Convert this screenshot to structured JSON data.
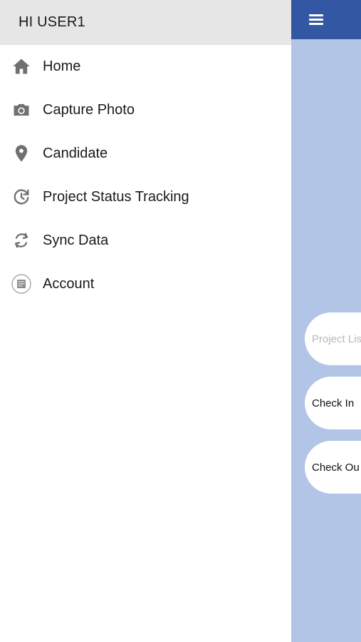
{
  "drawer": {
    "greeting": "HI USER1",
    "items": [
      {
        "label": "Home",
        "icon": "home-icon"
      },
      {
        "label": "Capture Photo",
        "icon": "camera-icon"
      },
      {
        "label": "Candidate",
        "icon": "location-pin-icon"
      },
      {
        "label": "Project Status Tracking",
        "icon": "history-icon"
      },
      {
        "label": "Sync Data",
        "icon": "sync-icon"
      },
      {
        "label": "Account",
        "icon": "account-icon"
      }
    ]
  },
  "main": {
    "menu_icon": "hamburger-menu-icon",
    "buttons": [
      {
        "label": "Project Lis"
      },
      {
        "label": "Check In"
      },
      {
        "label": "Check Ou"
      }
    ]
  },
  "colors": {
    "header_blue": "#3457a3",
    "background_blue": "#b2c5e6",
    "drawer_header": "#e6e6e6",
    "icon_gray": "#707070"
  }
}
